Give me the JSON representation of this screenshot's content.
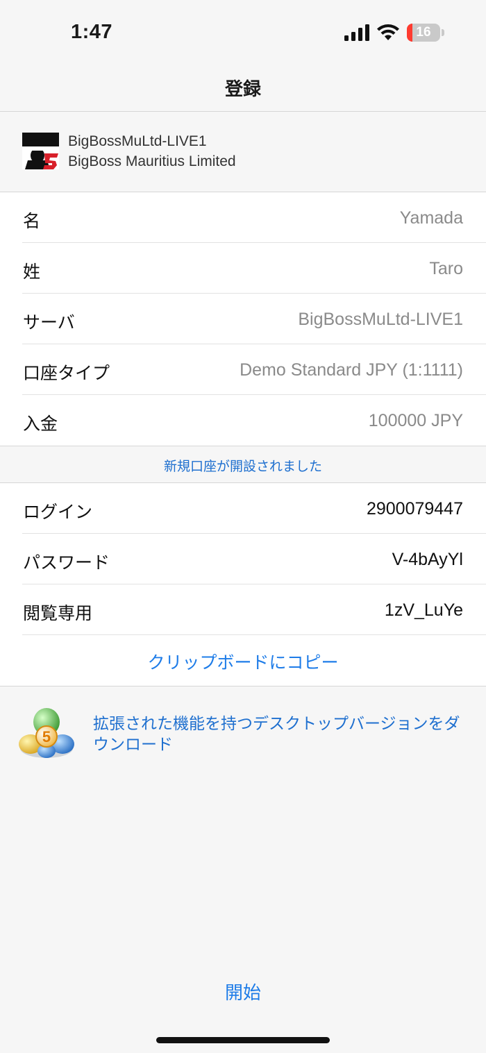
{
  "status_bar": {
    "time": "1:47",
    "battery_level": "16",
    "battery_color": "#ff3b30"
  },
  "nav": {
    "title": "登録"
  },
  "broker": {
    "server": "BigBossMuLtd-LIVE1",
    "company": "BigBoss Mauritius Limited"
  },
  "details": [
    {
      "label": "名",
      "value": "Yamada"
    },
    {
      "label": "姓",
      "value": "Taro"
    },
    {
      "label": "サーバ",
      "value": "BigBossMuLtd-LIVE1"
    },
    {
      "label": "口座タイプ",
      "value": "Demo Standard JPY (1:1111)"
    },
    {
      "label": "入金",
      "value": "100000 JPY"
    }
  ],
  "notice": "新規口座が開設されました",
  "credentials": [
    {
      "label": "ログイン",
      "value": "2900079447"
    },
    {
      "label": "パスワード",
      "value": "V-4bAyYl"
    },
    {
      "label": "閲覧専用",
      "value": "1zV_LuYe"
    }
  ],
  "copy_label": "クリップボードにコピー",
  "desktop_download": "拡張された機能を持つデスクトップバージョンをダウンロード",
  "start_label": "開始",
  "colors": {
    "accent": "#1e7ce8",
    "background": "#f6f6f6"
  }
}
